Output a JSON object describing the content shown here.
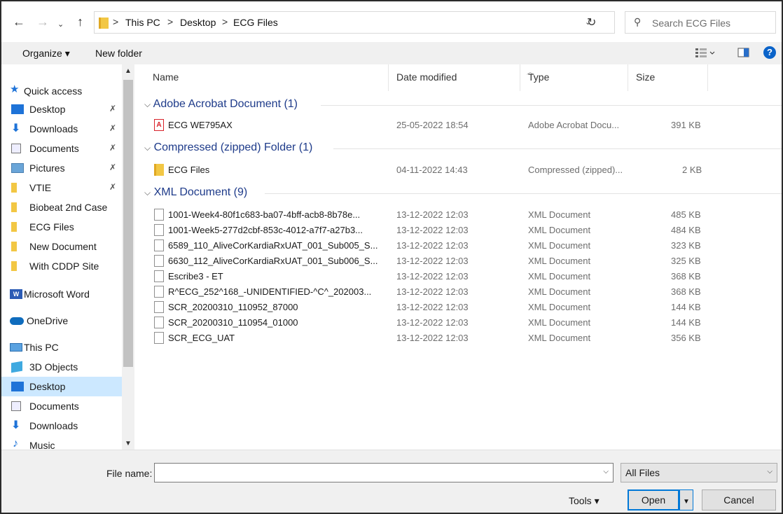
{
  "address": {
    "crumbs": [
      "This PC",
      "Desktop",
      "ECG Files"
    ],
    "separator": ">",
    "search_placeholder": "Search ECG Files"
  },
  "toolbar": {
    "organize_label": "Organize ▾",
    "new_folder_label": "New folder"
  },
  "nav": {
    "items": [
      {
        "label": "Quick access",
        "icon": "star-icon",
        "pinned": false
      },
      {
        "label": "Desktop",
        "icon": "desktop-icon",
        "pinned": true
      },
      {
        "label": "Downloads",
        "icon": "download-icon",
        "pinned": true
      },
      {
        "label": "Documents",
        "icon": "documents-icon",
        "pinned": true
      },
      {
        "label": "Pictures",
        "icon": "pictures-icon",
        "pinned": true
      },
      {
        "label": "VTIE",
        "icon": "folder-icon",
        "pinned": true
      },
      {
        "label": "Biobeat 2nd Case",
        "icon": "folder-icon",
        "pinned": false
      },
      {
        "label": "ECG Files",
        "icon": "folder-icon",
        "pinned": false
      },
      {
        "label": "New Document",
        "icon": "folder-icon",
        "pinned": false
      },
      {
        "label": "With CDDP Site",
        "icon": "folder-icon",
        "pinned": false
      },
      {
        "label": "Microsoft Word",
        "icon": "word-icon",
        "pinned": false
      },
      {
        "label": "OneDrive",
        "icon": "cloud-icon",
        "pinned": false
      },
      {
        "label": "This PC",
        "icon": "pc-icon",
        "pinned": false
      },
      {
        "label": "3D Objects",
        "icon": "cube-icon",
        "pinned": false
      },
      {
        "label": "Desktop",
        "icon": "desktop-icon",
        "pinned": false
      },
      {
        "label": "Documents",
        "icon": "documents-icon",
        "pinned": false
      },
      {
        "label": "Downloads",
        "icon": "download-icon",
        "pinned": false
      },
      {
        "label": "Music",
        "icon": "music-icon",
        "pinned": false
      }
    ],
    "selected_index": 14
  },
  "columns": {
    "name": "Name",
    "date": "Date modified",
    "type": "Type",
    "size": "Size"
  },
  "groups": [
    {
      "title": "Adobe Acrobat Document (1)",
      "files": [
        {
          "name": "ECG WE795AX",
          "date": "25-05-2022 18:54",
          "type": "Adobe Acrobat Docu...",
          "size": "391 KB",
          "icon": "pdf-icon"
        }
      ]
    },
    {
      "title": "Compressed (zipped) Folder (1)",
      "files": [
        {
          "name": "ECG Files",
          "date": "04-11-2022 14:43",
          "type": "Compressed (zipped)...",
          "size": "2 KB",
          "icon": "zip-icon"
        }
      ]
    },
    {
      "title": "XML Document (9)",
      "files": [
        {
          "name": "1001-Week4-80f1c683-ba07-4bff-acb8-8b78e...",
          "date": "13-12-2022 12:03",
          "type": "XML Document",
          "size": "485 KB",
          "icon": "document-icon"
        },
        {
          "name": "1001-Week5-277d2cbf-853c-4012-a7f7-a27b3...",
          "date": "13-12-2022 12:03",
          "type": "XML Document",
          "size": "484 KB",
          "icon": "document-icon"
        },
        {
          "name": "6589_110_AliveCorKardiaRxUAT_001_Sub005_S...",
          "date": "13-12-2022 12:03",
          "type": "XML Document",
          "size": "323 KB",
          "icon": "document-icon"
        },
        {
          "name": "6630_112_AliveCorKardiaRxUAT_001_Sub006_S...",
          "date": "13-12-2022 12:03",
          "type": "XML Document",
          "size": "325 KB",
          "icon": "document-icon"
        },
        {
          "name": "Escribe3 - ET",
          "date": "13-12-2022 12:03",
          "type": "XML Document",
          "size": "368 KB",
          "icon": "document-icon"
        },
        {
          "name": "R^ECG_252^168_-UNIDENTIFIED-^C^_202003...",
          "date": "13-12-2022 12:03",
          "type": "XML Document",
          "size": "368 KB",
          "icon": "document-icon"
        },
        {
          "name": "SCR_20200310_110952_87000",
          "date": "13-12-2022 12:03",
          "type": "XML Document",
          "size": "144 KB",
          "icon": "document-icon"
        },
        {
          "name": "SCR_20200310_110954_01000",
          "date": "13-12-2022 12:03",
          "type": "XML Document",
          "size": "144 KB",
          "icon": "document-icon"
        },
        {
          "name": "SCR_ECG_UAT",
          "date": "13-12-2022 12:03",
          "type": "XML Document",
          "size": "356 KB",
          "icon": "document-icon"
        }
      ]
    }
  ],
  "footer": {
    "file_name_label": "File name:",
    "file_name_value": "",
    "filter_value": "All Files",
    "tools_label": "Tools ▾",
    "open_label": "Open",
    "cancel_label": "Cancel"
  },
  "colors": {
    "selection": "#cce8ff",
    "group_heading": "#1e3b8a",
    "accent": "#0078d7"
  }
}
